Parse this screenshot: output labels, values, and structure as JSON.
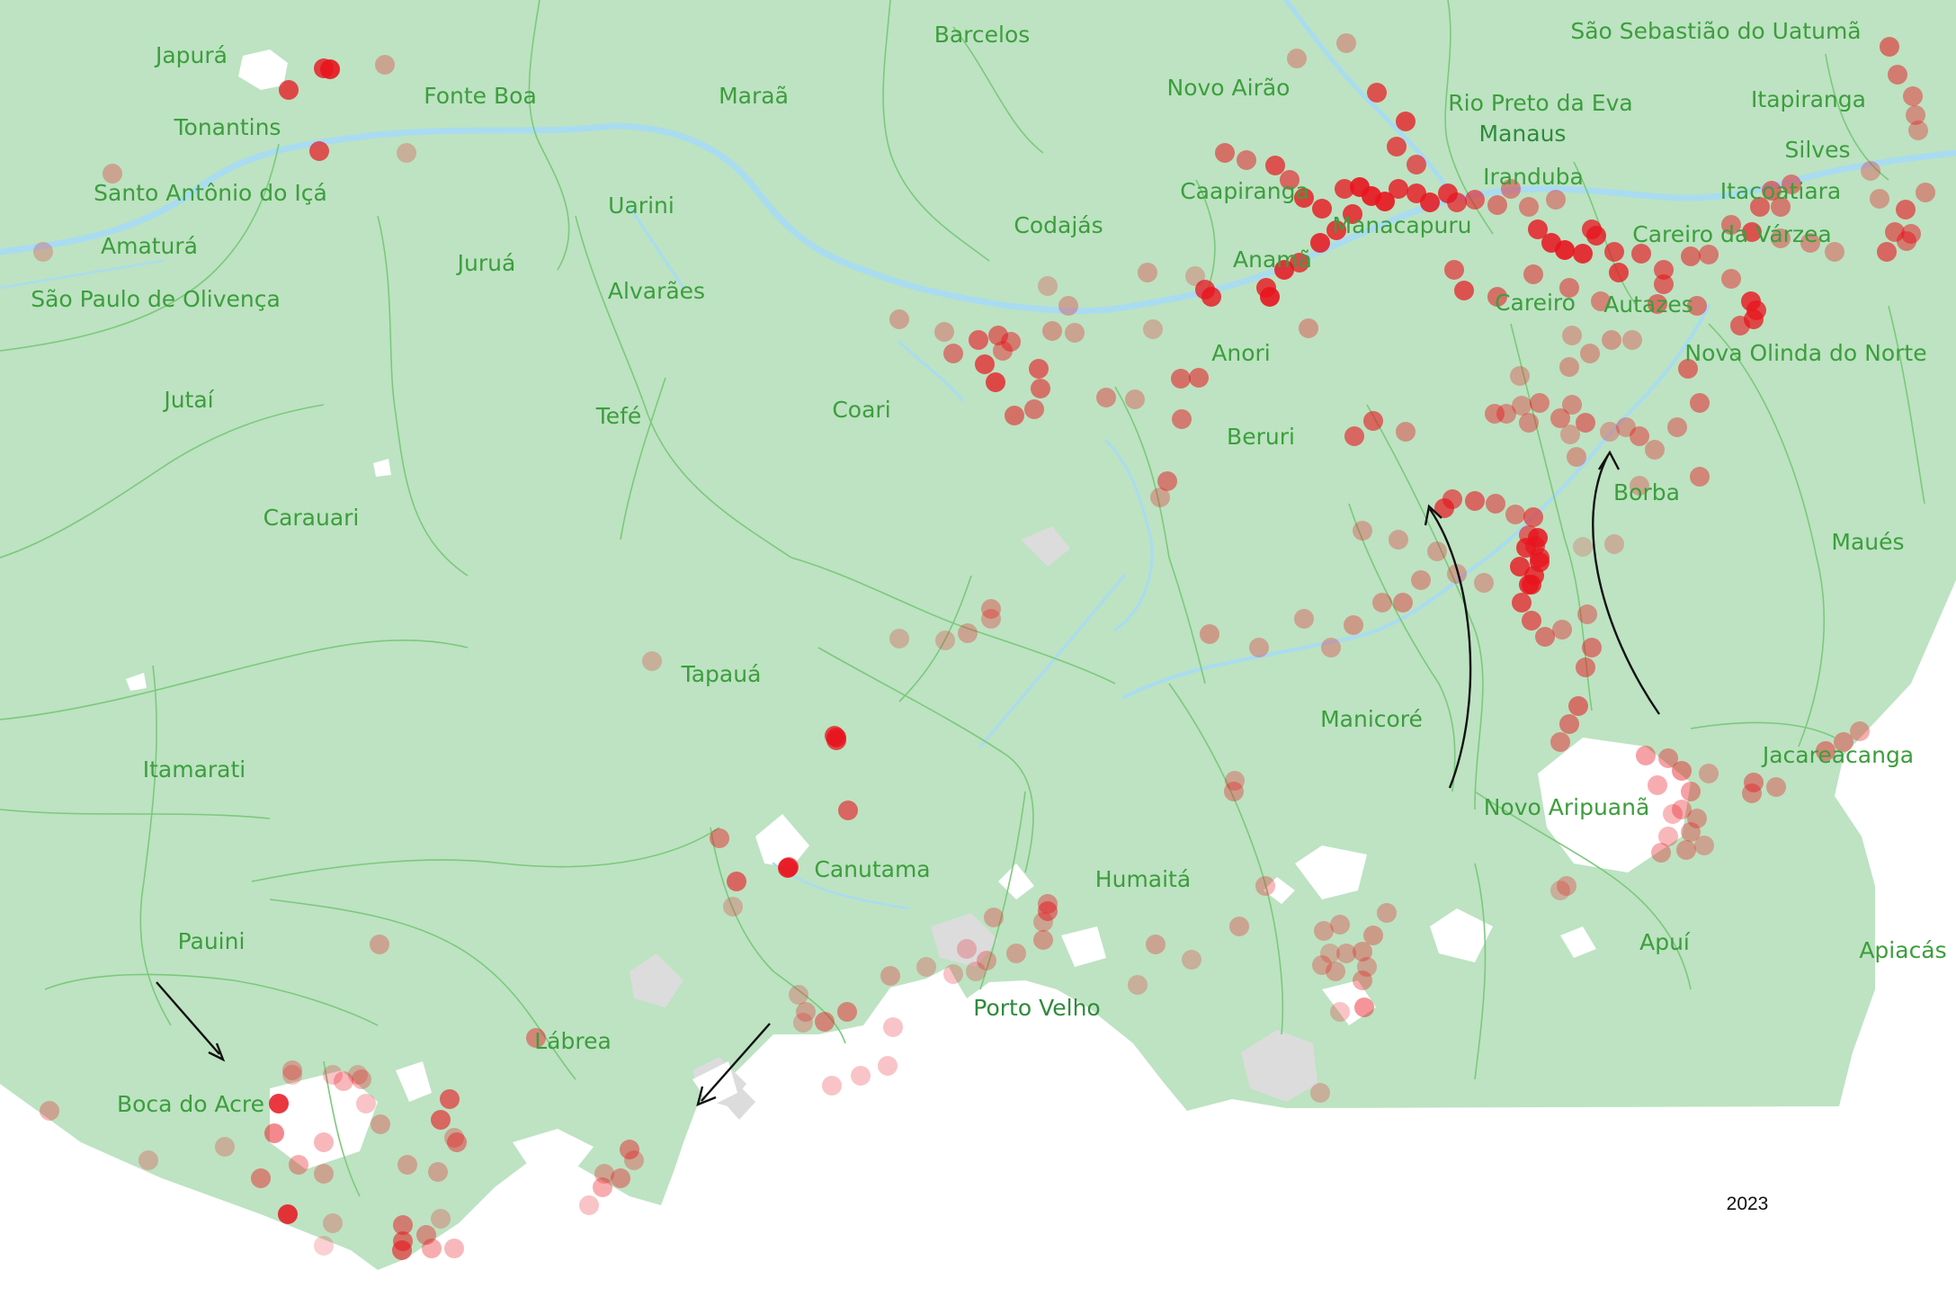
{
  "map": {
    "year": "2023",
    "colors": {
      "land": "#bde3c2",
      "boundary": "#7cc97c",
      "label": "#3c9e3c",
      "river": "#a9dcf0",
      "fire_point": "#e8141e",
      "cleared_land": "#ffffff",
      "outside": "#ffffff"
    },
    "place_labels": [
      "Japurá",
      "Fonte Boa",
      "Maraã",
      "Barcelos",
      "Novo Airão",
      "São Sebastião do Uatumã",
      "Rio Preto da Eva",
      "Manaus",
      "Itapiranga",
      "Tonantins",
      "Silves",
      "Iranduba",
      "Santo Antônio do Içá",
      "Uarini",
      "Caapiranga",
      "Itacoatiara",
      "Codajás",
      "Manacapuru",
      "Careiro da Várzea",
      "Amaturá",
      "Juruá",
      "Anamã",
      "Alvarães",
      "São Paulo de Olivença",
      "Careiro",
      "Autazes",
      "Anori",
      "Nova Olinda do Norte",
      "Jutaí",
      "Coari",
      "Tefé",
      "Beruri",
      "Borba",
      "Carauari",
      "Maués",
      "Tapauá",
      "Manicoré",
      "Jacareacanga",
      "Itamarati",
      "Novo Aripuanã",
      "Canutama",
      "Humaitá",
      "Pauini",
      "Apuí",
      "Apiacás",
      "Porto Velho",
      "Lábrea",
      "Boca do Acre"
    ]
  }
}
